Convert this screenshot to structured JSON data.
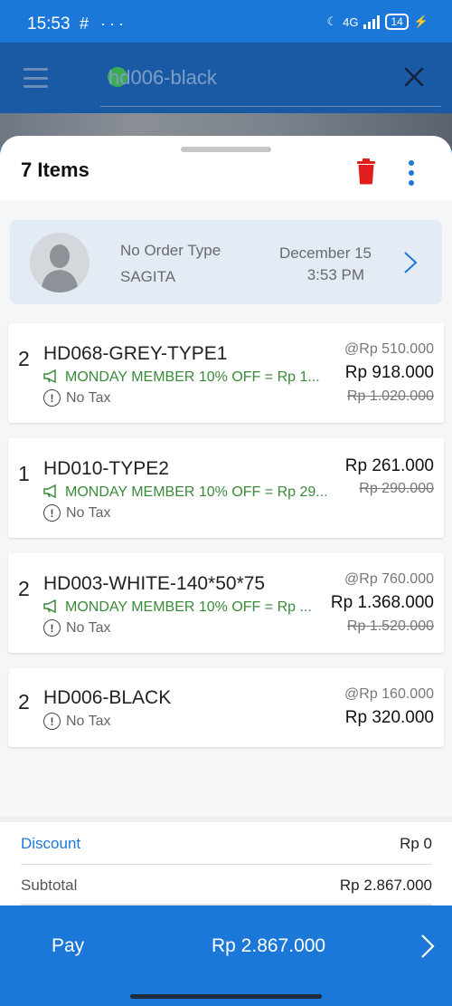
{
  "status_bar": {
    "time": "15:53",
    "left_icons": "# ···",
    "network": "4G",
    "battery": "14"
  },
  "search": {
    "query": "hd006-black"
  },
  "header": {
    "items_title": "7 Items"
  },
  "order": {
    "type": "No Order Type",
    "customer": "SAGITA",
    "date": "December 15",
    "time": "3:53 PM"
  },
  "items": [
    {
      "qty": "2",
      "name": "HD068-GREY-TYPE1",
      "promo": "MONDAY MEMBER 10% OFF = Rp 1...",
      "tax": "No Tax",
      "unit_price": "@Rp 510.000",
      "total_price": "Rp 918.000",
      "original_price": "Rp 1.020.000"
    },
    {
      "qty": "1",
      "name": "HD010-TYPE2",
      "promo": "MONDAY MEMBER 10% OFF = Rp 29...",
      "tax": "No Tax",
      "total_price": "Rp 261.000",
      "original_price": "Rp 290.000"
    },
    {
      "qty": "2",
      "name": "HD003-WHITE-140*50*75",
      "promo": "MONDAY MEMBER 10% OFF = Rp ...",
      "tax": "No Tax",
      "unit_price": "@Rp 760.000",
      "total_price": "Rp 1.368.000",
      "original_price": "Rp 1.520.000"
    },
    {
      "qty": "2",
      "name": "HD006-BLACK",
      "tax": "No Tax",
      "unit_price": "@Rp 160.000",
      "total_price": "Rp 320.000"
    }
  ],
  "summary": {
    "discount_label": "Discount",
    "discount_value": "Rp 0",
    "subtotal_label": "Subtotal",
    "subtotal_value": "Rp 2.867.000"
  },
  "pay": {
    "label": "Pay",
    "amount": "Rp 2.867.000"
  },
  "colors": {
    "primary": "#1b78d8",
    "header_dark": "#1a5aa5",
    "delete_red": "#e11d1d",
    "promo_green": "#3a8a3a"
  },
  "icons": [
    "menu-icon",
    "close-icon",
    "trash-icon",
    "more-vert-icon",
    "avatar-icon",
    "chevron-right-icon",
    "megaphone-icon",
    "info-circle-icon"
  ]
}
